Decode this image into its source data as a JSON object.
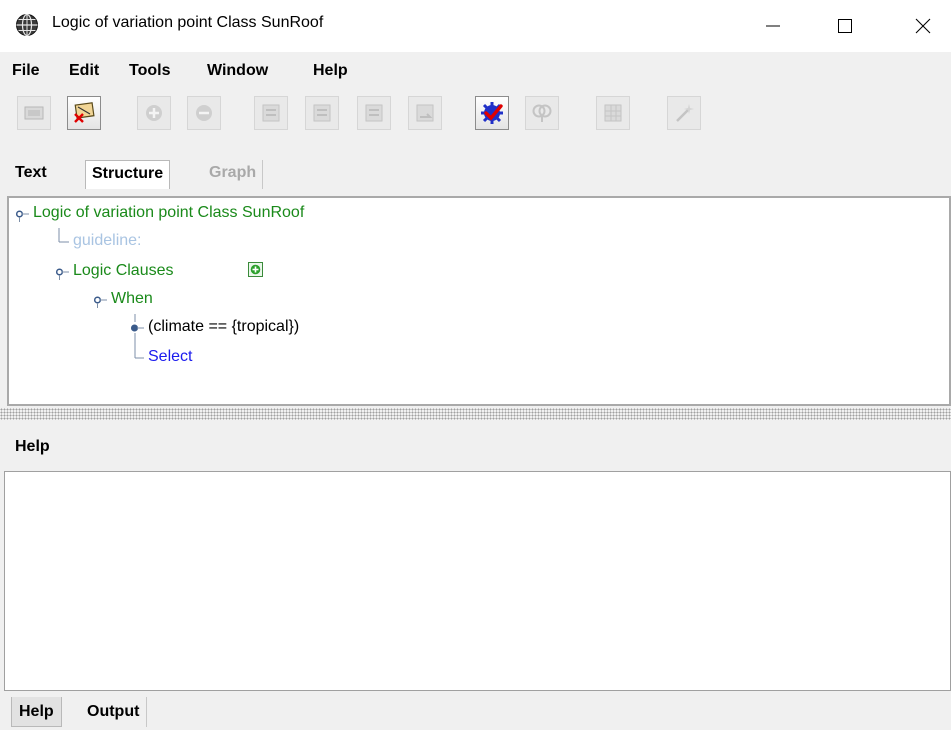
{
  "window": {
    "title": "Logic of variation point Class SunRoof",
    "app_icon": "globe-icon",
    "controls": [
      "minimize-icon",
      "maximize-icon",
      "close-icon"
    ]
  },
  "menu": {
    "items": [
      "File",
      "Edit",
      "Tools",
      "Window",
      "Help"
    ]
  },
  "toolbar": {
    "buttons": [
      {
        "icon": "view-icon",
        "enabled": false
      },
      {
        "icon": "delete-logic-icon",
        "enabled": true
      },
      {
        "icon": "add-icon",
        "enabled": false
      },
      {
        "icon": "remove-icon",
        "enabled": false
      },
      {
        "icon": "move-up-icon",
        "enabled": false
      },
      {
        "icon": "move-down-icon",
        "enabled": false
      },
      {
        "icon": "move-left-icon",
        "enabled": false
      },
      {
        "icon": "move-right-icon",
        "enabled": false
      },
      {
        "icon": "check-icon",
        "enabled": true
      },
      {
        "icon": "find-icon",
        "enabled": false
      },
      {
        "icon": "table-icon",
        "enabled": false
      },
      {
        "icon": "wizard-icon",
        "enabled": false
      }
    ]
  },
  "top_tabs": {
    "text": "Text",
    "structure": "Structure",
    "graph": "Graph",
    "active": "Structure"
  },
  "tree": {
    "root": "Logic of variation point Class SunRoof",
    "guideline": "guideline:",
    "logic_clauses": "Logic Clauses",
    "when": "When",
    "condition": "(climate == {tropical})",
    "select": "Select"
  },
  "help_panel": {
    "header": "Help",
    "content": ""
  },
  "bottom_tabs": {
    "help": "Help",
    "output": "Output",
    "active": "Help"
  },
  "colors": {
    "tree_green": "#1a8a1a",
    "select_blue": "#1a1aee",
    "disabled_text": "#a9c4e2"
  }
}
